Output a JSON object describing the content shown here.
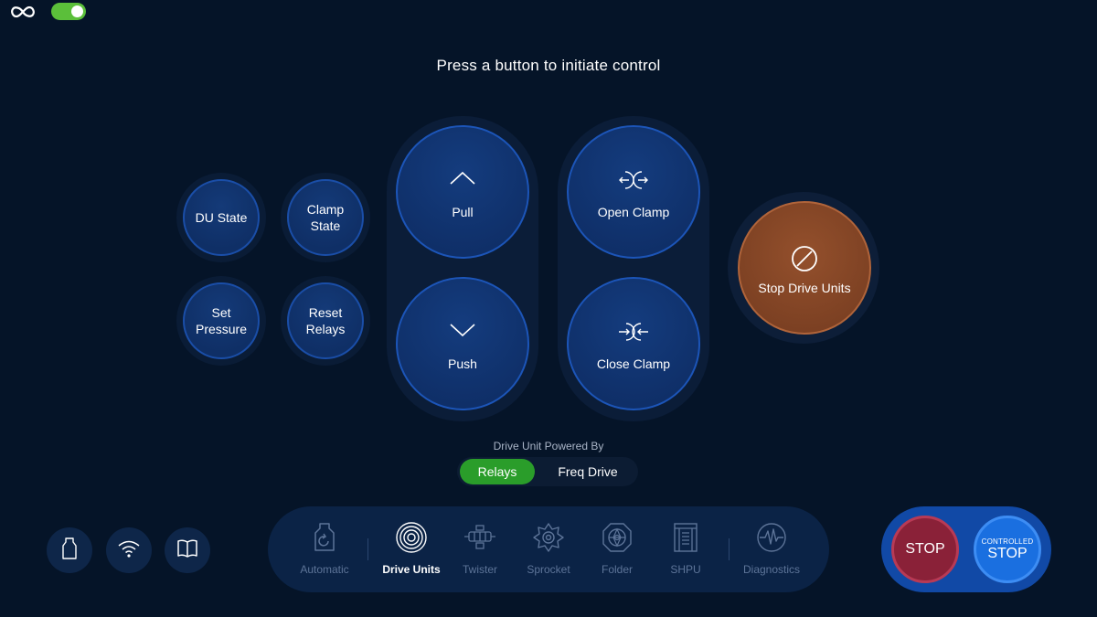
{
  "header": {
    "logo_icon": "infinity-icon",
    "toggle_on": true
  },
  "prompt": "Press a button to initiate control",
  "small_buttons": [
    {
      "label": "DU State"
    },
    {
      "label": "Clamp\nState"
    },
    {
      "label": "Set\nPressure"
    },
    {
      "label": "Reset\nRelays"
    }
  ],
  "drive": {
    "pull": "Pull",
    "push": "Push"
  },
  "clamp": {
    "open": "Open Clamp",
    "close": "Close Clamp"
  },
  "stop_drive_units": "Stop Drive Units",
  "powered_by": {
    "label": "Drive Unit Powered By",
    "options": [
      "Relays",
      "Freq Drive"
    ],
    "selected": "Relays"
  },
  "bottom_icons": [
    "bag-icon",
    "wifi-icon",
    "book-icon"
  ],
  "tabs": [
    {
      "label": "Automatic",
      "icon": "automatic-icon",
      "active": false
    },
    {
      "label": "Drive Units",
      "icon": "drive-units-icon",
      "active": true
    },
    {
      "label": "Twister",
      "icon": "twister-icon",
      "active": false
    },
    {
      "label": "Sprocket",
      "icon": "sprocket-icon",
      "active": false
    },
    {
      "label": "Folder",
      "icon": "folder-icon",
      "active": false
    },
    {
      "label": "SHPU",
      "icon": "shpu-icon",
      "active": false
    },
    {
      "label": "Diagnostics",
      "icon": "diagnostics-icon",
      "active": false
    }
  ],
  "stop": {
    "label": "STOP"
  },
  "controlled_stop": {
    "small": "CONTROLLED",
    "big": "STOP"
  },
  "colors": {
    "background": "#051428",
    "button_blue": "#0f2f66",
    "stop_orange": "#7a3f22",
    "active_green": "#2a9d2a",
    "stop_red": "#8a2138",
    "controlled_blue": "#1a6fe0"
  }
}
